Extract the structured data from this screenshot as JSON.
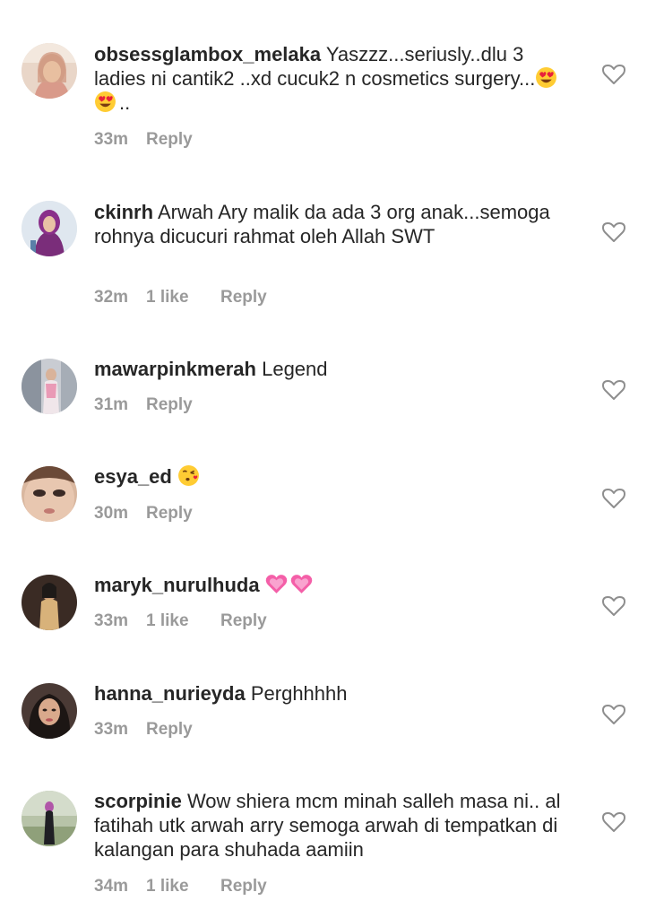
{
  "comments": [
    {
      "username": "obsessglambox_melaka",
      "text": "Yaszzz...seriusly..dlu 3 ladies ni cantik2 ..xd cucuk2 n cosmetics surgery...",
      "emoji": [
        "heart-eyes-emoji",
        "heart-eyes-emoji"
      ],
      "suffix": "..",
      "time": "33m",
      "likes": "",
      "reply_label": "Reply"
    },
    {
      "username": "ckinrh",
      "text": "Arwah Ary malik da ada 3 org anak...semoga rohnya dicucuri  rahmat oleh Allah SWT",
      "emoji": [],
      "suffix": "",
      "time": "32m",
      "likes": "1 like",
      "reply_label": "Reply"
    },
    {
      "username": "mawarpinkmerah",
      "text": "Legend",
      "emoji": [],
      "suffix": "",
      "time": "31m",
      "likes": "",
      "reply_label": "Reply"
    },
    {
      "username": "esya_ed",
      "text": "",
      "emoji": [
        "kiss-emoji"
      ],
      "suffix": "",
      "time": "30m",
      "likes": "",
      "reply_label": "Reply"
    },
    {
      "username": "maryk_nurulhuda",
      "text": "",
      "emoji": [
        "pink-heart-emoji",
        "pink-heart-emoji"
      ],
      "suffix": "",
      "time": "33m",
      "likes": "1 like",
      "reply_label": "Reply"
    },
    {
      "username": "hanna_nurieyda",
      "text": "Perghhhhh",
      "emoji": [],
      "suffix": "",
      "time": "33m",
      "likes": "",
      "reply_label": "Reply"
    },
    {
      "username": "scorpinie",
      "text": "Wow shiera mcm minah salleh masa ni.. al fatihah utk arwah arry semoga arwah di tempatkan di kalangan para shuhada aamiin",
      "emoji": [],
      "suffix": "",
      "time": "34m",
      "likes": "1 like",
      "reply_label": "Reply"
    }
  ],
  "colors": {
    "text": "#262626",
    "meta": "#9a9a9a",
    "heart_outline": "#8e8e8e"
  }
}
